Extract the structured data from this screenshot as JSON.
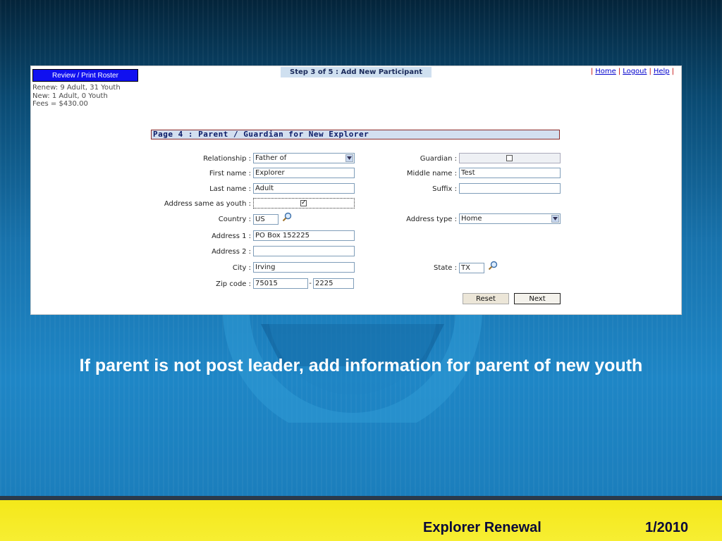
{
  "header": {
    "roster_button": "Review / Print Roster",
    "summary": [
      "Renew: 9 Adult, 31 Youth",
      "New: 1 Adult, 0 Youth",
      "Fees = $430.00"
    ],
    "step": "Step 3 of 5 : Add New Participant",
    "links": [
      "Home",
      "Logout",
      "Help"
    ]
  },
  "form": {
    "title": "Page 4 : Parent / Guardian for New Explorer",
    "relationship": {
      "label": "Relationship :",
      "value": "Father of"
    },
    "first_name": {
      "label": "First name :",
      "value": "Explorer"
    },
    "last_name": {
      "label": "Last name :",
      "value": "Adult"
    },
    "address_same": {
      "label": "Address same as youth :",
      "checked": true
    },
    "country": {
      "label": "Country :",
      "value": "US"
    },
    "address1": {
      "label": "Address 1 :",
      "value": "PO Box 152225"
    },
    "address2": {
      "label": "Address 2 :",
      "value": ""
    },
    "city": {
      "label": "City :",
      "value": "Irving"
    },
    "zip": {
      "label": "Zip code :",
      "value": "75015",
      "sep": "-",
      "ext": "2225"
    },
    "guardian": {
      "label": "Guardian :",
      "checked": false
    },
    "middle_name": {
      "label": "Middle name :",
      "value": "Test"
    },
    "suffix": {
      "label": "Suffix :",
      "value": ""
    },
    "address_type": {
      "label": "Address type :",
      "value": "Home"
    },
    "state": {
      "label": "State :",
      "value": "TX"
    },
    "reset_label": "Reset",
    "next_label": "Next"
  },
  "caption": "If parent is not post leader, add information for parent of new youth",
  "footer": {
    "title": "Explorer Renewal",
    "date": "1/2010"
  },
  "colors": {
    "footer_bg": "#f4e81a",
    "roster_button_bg": "#1010f0",
    "section_bg": "#d3dff0"
  }
}
